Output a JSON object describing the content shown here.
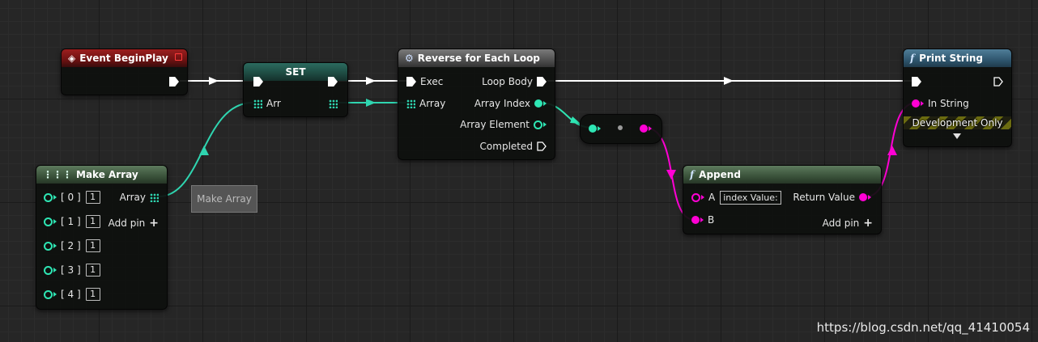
{
  "colors": {
    "exec": "#ffffff",
    "integer": "#2ee6b4",
    "string": "#ff00d4",
    "array_int": "#2fd5b0",
    "event_header": "#8a1a1a",
    "function_header": "#3f6d88"
  },
  "nodes": {
    "event_begin_play": {
      "title": "Event BeginPlay",
      "icon": "event-diamond-icon"
    },
    "set": {
      "title": "SET",
      "pin_arr": "Arr"
    },
    "reverse_loop": {
      "title": "Reverse for Each Loop",
      "icon": "loop-gear-icon",
      "pin_exec": "Exec",
      "pin_array": "Array",
      "pin_loop_body": "Loop Body",
      "pin_array_index": "Array Index",
      "pin_array_element": "Array Element",
      "pin_completed": "Completed"
    },
    "make_array": {
      "title": "Make Array",
      "icon": "make-array-icon",
      "pin_array": "Array",
      "add_pin": "Add pin",
      "items": [
        {
          "label": "[ 0 ]",
          "value": "1"
        },
        {
          "label": "[ 1 ]",
          "value": "1"
        },
        {
          "label": "[ 2 ]",
          "value": "1"
        },
        {
          "label": "[ 3 ]",
          "value": "1"
        },
        {
          "label": "[ 4 ]",
          "value": "1"
        }
      ]
    },
    "append": {
      "title": "Append",
      "icon": "function-icon",
      "pin_a": "A",
      "pin_a_value": "index Value:",
      "pin_b": "B",
      "return_value": "Return Value",
      "add_pin": "Add pin"
    },
    "print_string": {
      "title": "Print String",
      "icon": "function-icon",
      "pin_in_string": "In String",
      "development_only": "Development Only"
    }
  },
  "tooltip": "Make Array",
  "watermark": "https://blog.csdn.net/qq_41410054"
}
